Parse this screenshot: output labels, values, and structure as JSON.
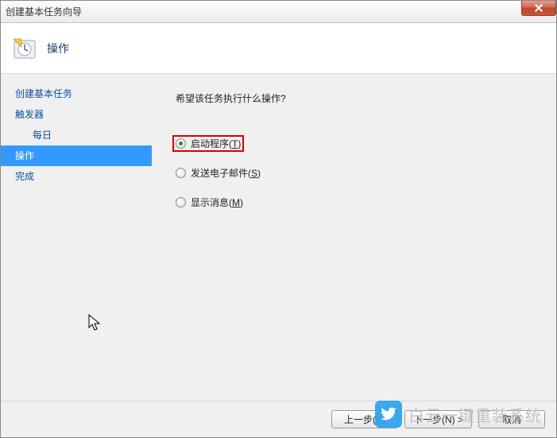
{
  "window": {
    "title": "创建基本任务向导"
  },
  "header": {
    "title": "操作"
  },
  "sidebar": {
    "items": [
      {
        "label": "创建基本任务",
        "selected": false,
        "sub": false
      },
      {
        "label": "触发器",
        "selected": false,
        "sub": false
      },
      {
        "label": "每日",
        "selected": false,
        "sub": true
      },
      {
        "label": "操作",
        "selected": true,
        "sub": false
      },
      {
        "label": "完成",
        "selected": false,
        "sub": false
      }
    ]
  },
  "content": {
    "prompt": "希望该任务执行什么操作?",
    "options": [
      {
        "label": "启动程序",
        "accel": "T",
        "checked": true,
        "highlighted": true
      },
      {
        "label": "发送电子邮件",
        "accel": "S",
        "checked": false,
        "highlighted": false
      },
      {
        "label": "显示消息",
        "accel": "M",
        "checked": false,
        "highlighted": false
      }
    ]
  },
  "buttons": {
    "back": "上一步(B)",
    "next": "下一步(N) >",
    "cancel": "取消"
  },
  "watermark": {
    "text": "白云一键重装系统"
  }
}
